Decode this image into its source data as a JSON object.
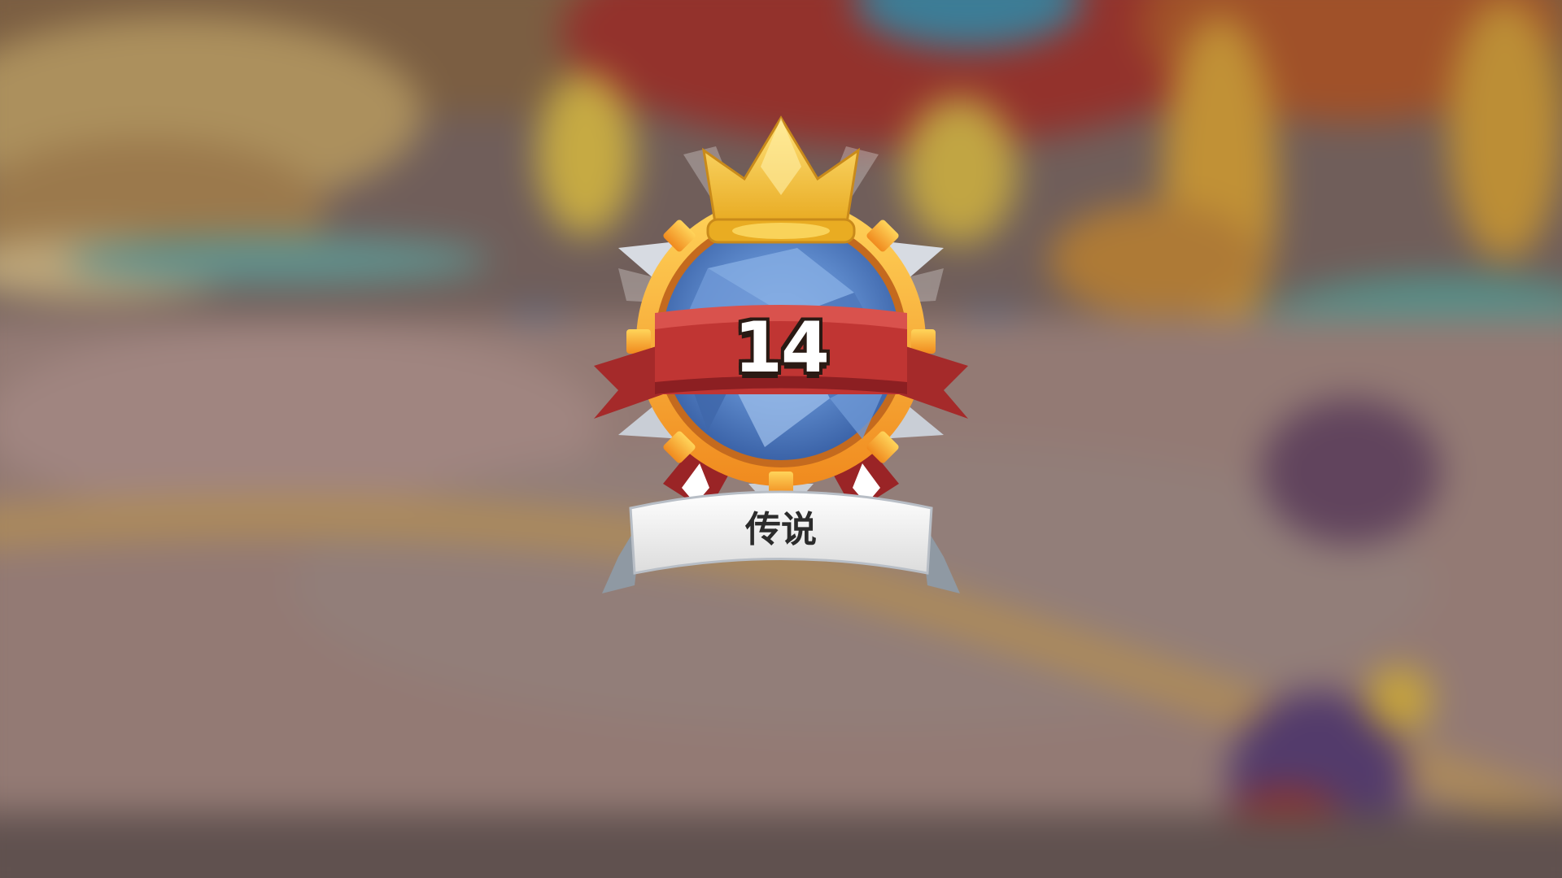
{
  "rank": {
    "level": "14",
    "title": "传说"
  },
  "colors": {
    "crown": "#f3c43c",
    "gem": "#5b87c9",
    "ribbon_red": "#b3302e",
    "gold_ring": "#f4a92c",
    "banner": "#f2f2f2"
  },
  "icons": {
    "crown": "crown-icon",
    "gem": "gem-icon",
    "emblem": "rank-emblem"
  }
}
